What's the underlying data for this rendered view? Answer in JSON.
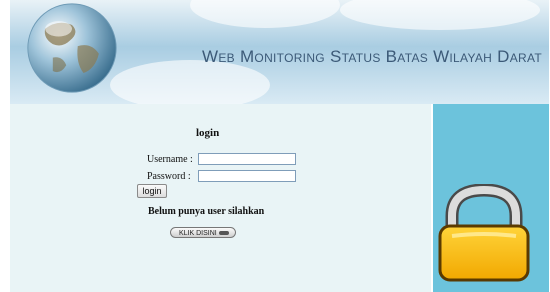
{
  "banner": {
    "title": "Web Monitoring Status Batas Wilayah Darat"
  },
  "login": {
    "heading": "login",
    "username_label": "Username :",
    "password_label": "Password :",
    "username_value": "",
    "password_value": "",
    "submit_label": "login",
    "register_prompt": "Belum punya user silahkan",
    "register_button": "KLIK DISINI"
  },
  "icons": {
    "globe": "globe-icon",
    "lock": "padlock-icon",
    "arrow": "arrow-icon"
  },
  "colors": {
    "panel_bg": "#e9f4f6",
    "side_bg": "#6cc3dc",
    "banner_text": "#3c5a78"
  }
}
